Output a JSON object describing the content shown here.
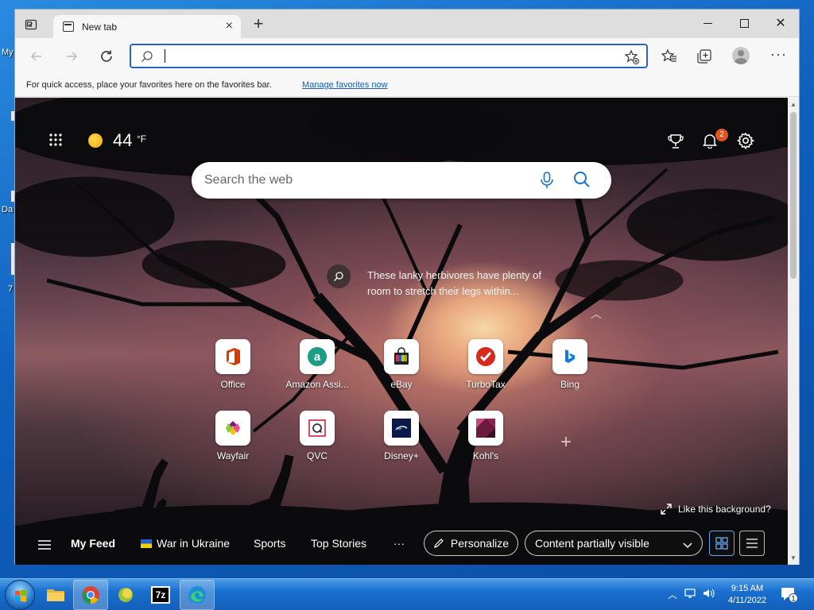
{
  "desktop": {
    "labels": [
      "My",
      "Da",
      "7"
    ]
  },
  "browser": {
    "tab_title": "New tab",
    "tab_close": "×",
    "new_tab": "+",
    "window_close": "✕",
    "address_placeholder": "",
    "favorites_bar_text": "For quick access, place your favorites here on the favorites bar.",
    "favorites_bar_link": "Manage favorites now",
    "more_menu": "···"
  },
  "newtab": {
    "weather_temp": "44",
    "weather_unit": "°F",
    "notification_count": "2",
    "search_placeholder": "Search the web",
    "bg_info_text": "These lanky herbivores have plenty of room to stretch their legs within...",
    "like_background": "Like this background?",
    "quicklinks": [
      {
        "label": "Office",
        "icon": "office-icon"
      },
      {
        "label": "Amazon Assi...",
        "icon": "amazon-icon"
      },
      {
        "label": "eBay",
        "icon": "ebay-icon"
      },
      {
        "label": "TurboTax",
        "icon": "turbotax-icon"
      },
      {
        "label": "Bing",
        "icon": "bing-icon"
      },
      {
        "label": "Wayfair",
        "icon": "wayfair-icon"
      },
      {
        "label": "QVC",
        "icon": "qvc-icon"
      },
      {
        "label": "Disney+",
        "icon": "disney-icon"
      },
      {
        "label": "Kohl's",
        "icon": "kohls-icon"
      }
    ],
    "feed": {
      "my_feed": "My Feed",
      "war_in_ukraine": "War in Ukraine",
      "sports": "Sports",
      "top_stories": "Top Stories",
      "more": "···",
      "personalize": "Personalize",
      "content_visibility": "Content partially visible"
    }
  },
  "taskbar": {
    "time": "9:15 AM",
    "date": "4/11/2022",
    "action_center_count": "1",
    "apps": [
      "file-explorer-icon",
      "chrome-icon",
      "green-app-icon",
      "7zip-icon",
      "edge-icon"
    ],
    "sevenzip_label": "7z"
  },
  "colors": {
    "accent": "#2a62c9",
    "notification_badge": "#e0531f",
    "taskbar": "#1a6fcf"
  }
}
